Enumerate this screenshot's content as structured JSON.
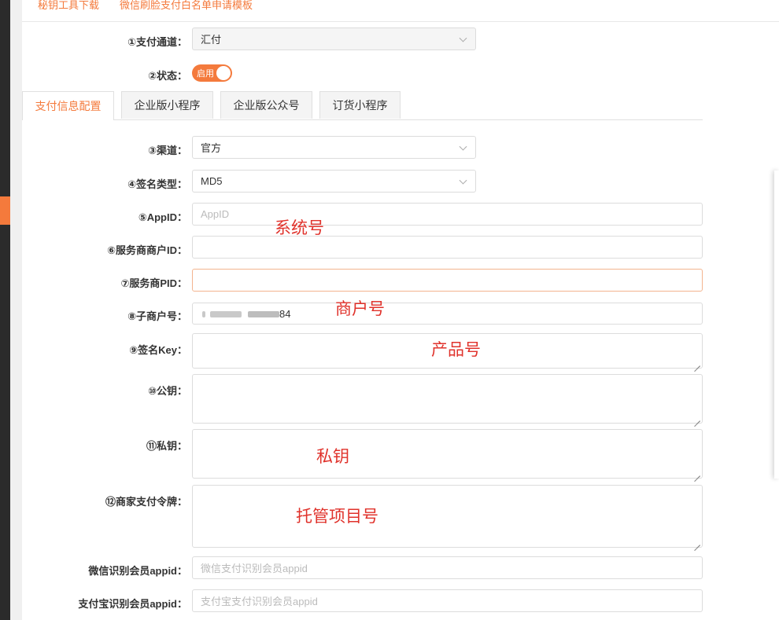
{
  "top_links": [
    "秘钥工具下载",
    "微信刷脸支付白名单申请模板"
  ],
  "payment_channel": {
    "label": "①支付通道：",
    "value": "汇付"
  },
  "status": {
    "label": "②状态：",
    "toggle_text": "启用"
  },
  "tabs": [
    {
      "label": "支付信息配置",
      "active": true
    },
    {
      "label": "企业版小程序",
      "active": false
    },
    {
      "label": "企业版公众号",
      "active": false
    },
    {
      "label": "订货小程序",
      "active": false
    }
  ],
  "form": {
    "channel": {
      "label": "③渠道：",
      "value": "官方"
    },
    "sign_type": {
      "label": "④签名类型：",
      "value": "MD5"
    },
    "appid": {
      "label": "⑤AppID：",
      "placeholder": "AppID"
    },
    "sp_mch_id": {
      "label": "⑥服务商商户ID："
    },
    "sp_pid": {
      "label": "⑦服务商PID："
    },
    "sub_mch_no": {
      "label": "⑧子商户号：",
      "value_suffix": "84"
    },
    "sign_key": {
      "label": "⑨签名Key："
    },
    "public_key": {
      "label": "⑩公钥："
    },
    "private_key": {
      "label": "⑪私钥："
    },
    "merchant_token": {
      "label": "⑫商家支付令牌："
    },
    "wx_member_appid": {
      "label": "微信识别会员appid：",
      "placeholder": "微信支付识别会员appid"
    },
    "ali_member_appid": {
      "label": "支付宝识别会员appid：",
      "placeholder": "支付宝支付识别会员appid"
    }
  },
  "annotations": {
    "system_no": "系统号",
    "merchant_no": "商户号",
    "product_no": "产品号",
    "private_key": "私钥",
    "custody_project_no": "托管项目号"
  },
  "colors": {
    "accent": "#f47a3c",
    "annotation": "#e0322b"
  }
}
